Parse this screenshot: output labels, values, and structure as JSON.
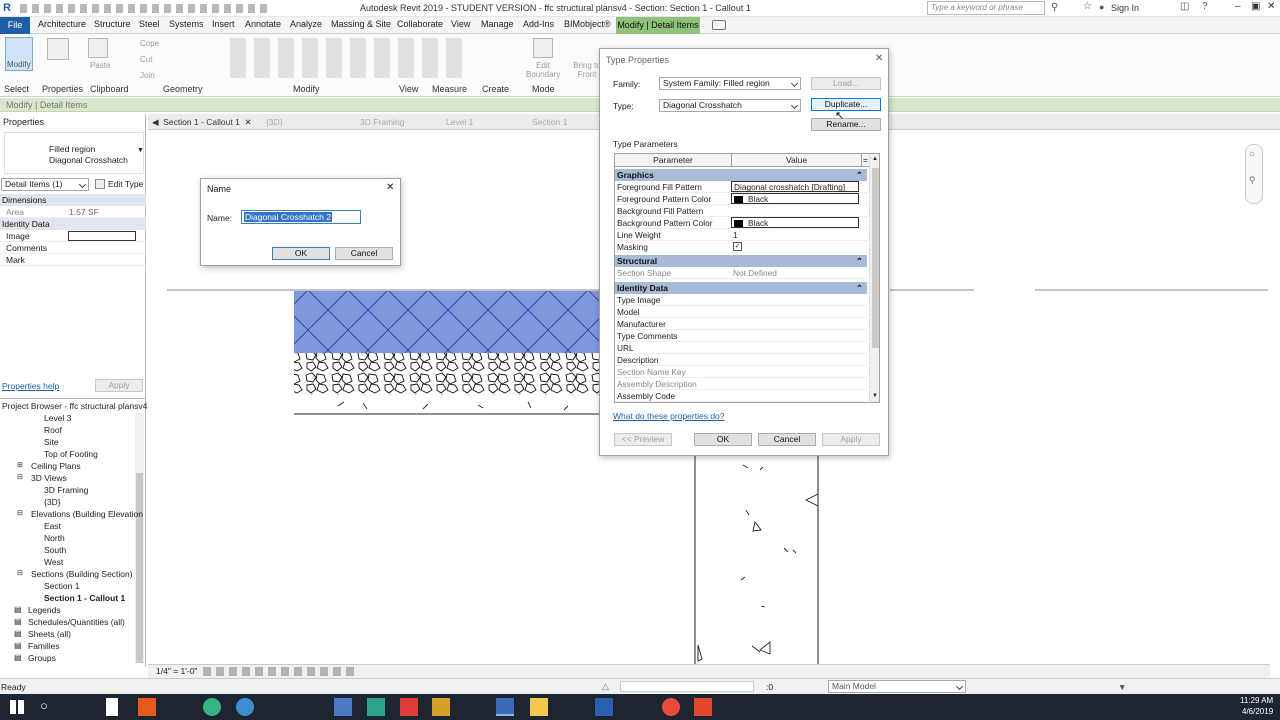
{
  "app": {
    "title": "Autodesk Revit 2019 - STUDENT VERSION - ffc structural plansv4 - Section: Section 1 - Callout 1",
    "search_placeholder": "Type a keyword or phrase",
    "sign_in": "Sign In"
  },
  "ribbon": {
    "tabs": [
      "File",
      "Architecture",
      "Structure",
      "Steel",
      "Systems",
      "Insert",
      "Annotate",
      "Analyze",
      "Massing & Site",
      "Collaborate",
      "View",
      "Manage",
      "Add-Ins",
      "BIMobject®",
      "Modify | Detail Items"
    ],
    "groups": [
      "Select",
      "Properties",
      "Clipboard",
      "Geometry",
      "Modify",
      "View",
      "Measure",
      "Create",
      "Mode"
    ],
    "tools": {
      "modify": "Modify",
      "paste": "Paste",
      "cope": "Cope",
      "cut": "Cut",
      "join": "Join",
      "edit_boundary": "Edit Boundary",
      "bring_to_front": "Bring to Front"
    },
    "context_label": "Modify | Detail Items"
  },
  "properties": {
    "header": "Properties",
    "type_line1": "Filled region",
    "type_line2": "Diagonal Crosshatch",
    "selector": "Detail Items (1)",
    "edit_type": "Edit Type",
    "sections": {
      "dimensions": "Dimensions",
      "identity": "Identity Data"
    },
    "rows": {
      "area_label": "Area",
      "area_value": "1.57 SF",
      "image_label": "Image",
      "comments_label": "Comments",
      "mark_label": "Mark"
    },
    "help_link": "Properties help",
    "apply": "Apply"
  },
  "browser": {
    "header": "Project Browser - ffc structural plansv4",
    "items": [
      "Level 3",
      "Roof",
      "Site",
      "Top of Footing",
      "Ceiling Plans",
      "3D Views",
      "3D Framing",
      "{3D}",
      "Elevations (Building Elevation",
      "East",
      "North",
      "South",
      "West",
      "Sections (Building Section)",
      "Section 1",
      "Section 1 - Callout 1",
      "Legends",
      "Schedules/Quantities (all)",
      "Sheets (all)",
      "Families",
      "Groups"
    ]
  },
  "view_tabs": [
    "Section 1 - Callout 1",
    "{3D}",
    "3D Framing",
    "Level 1",
    "Section 1"
  ],
  "name_dialog": {
    "title": "Name",
    "label": "Name:",
    "value": "Diagonal Crosshatch 2",
    "ok": "OK",
    "cancel": "Cancel"
  },
  "type_properties": {
    "title": "Type Properties",
    "family_label": "Family:",
    "family_value": "System Family: Filled region",
    "type_label": "Type:",
    "type_value": "Diagonal Crosshatch",
    "load": "Load...",
    "duplicate": "Duplicate...",
    "rename": "Rename...",
    "section_label": "Type Parameters",
    "col_param": "Parameter",
    "col_value": "Value",
    "col_eq": "=",
    "groups": {
      "graphics": "Graphics",
      "structural": "Structural",
      "identity": "Identity Data"
    },
    "graphics_rows": [
      {
        "k": "Foreground Fill Pattern",
        "v": "Diagonal crosshatch [Drafting]"
      },
      {
        "k": "Foreground Pattern Color",
        "v": "Black"
      },
      {
        "k": "Background Fill Pattern",
        "v": ""
      },
      {
        "k": "Background Pattern Color",
        "v": "Black"
      },
      {
        "k": "Line Weight",
        "v": "1"
      },
      {
        "k": "Masking",
        "v": ""
      }
    ],
    "structural_rows": [
      {
        "k": "Section Shape",
        "v": "Not Defined"
      }
    ],
    "identity_rows": [
      {
        "k": "Type Image",
        "v": ""
      },
      {
        "k": "Model",
        "v": ""
      },
      {
        "k": "Manufacturer",
        "v": ""
      },
      {
        "k": "Type Comments",
        "v": ""
      },
      {
        "k": "URL",
        "v": ""
      },
      {
        "k": "Description",
        "v": ""
      },
      {
        "k": "Section Name Key",
        "v": ""
      },
      {
        "k": "Assembly Description",
        "v": ""
      },
      {
        "k": "Assembly Code",
        "v": ""
      }
    ],
    "help_link": "What do these properties do?",
    "preview": "<< Preview",
    "ok": "OK",
    "cancel": "Cancel",
    "apply": "Apply"
  },
  "viewbar": {
    "scale": "1/4\" = 1'-0\""
  },
  "status": {
    "text": "Ready",
    "zero": ":0",
    "model": "Main Model"
  },
  "clock": {
    "time": "11:29 AM",
    "date": "4/6/2019"
  },
  "colors": {
    "accent": "#1f5fa8",
    "context_tab": "#8fc27a",
    "hatch_fill": "#7f97dc",
    "param_group": "#a8bbd6"
  }
}
